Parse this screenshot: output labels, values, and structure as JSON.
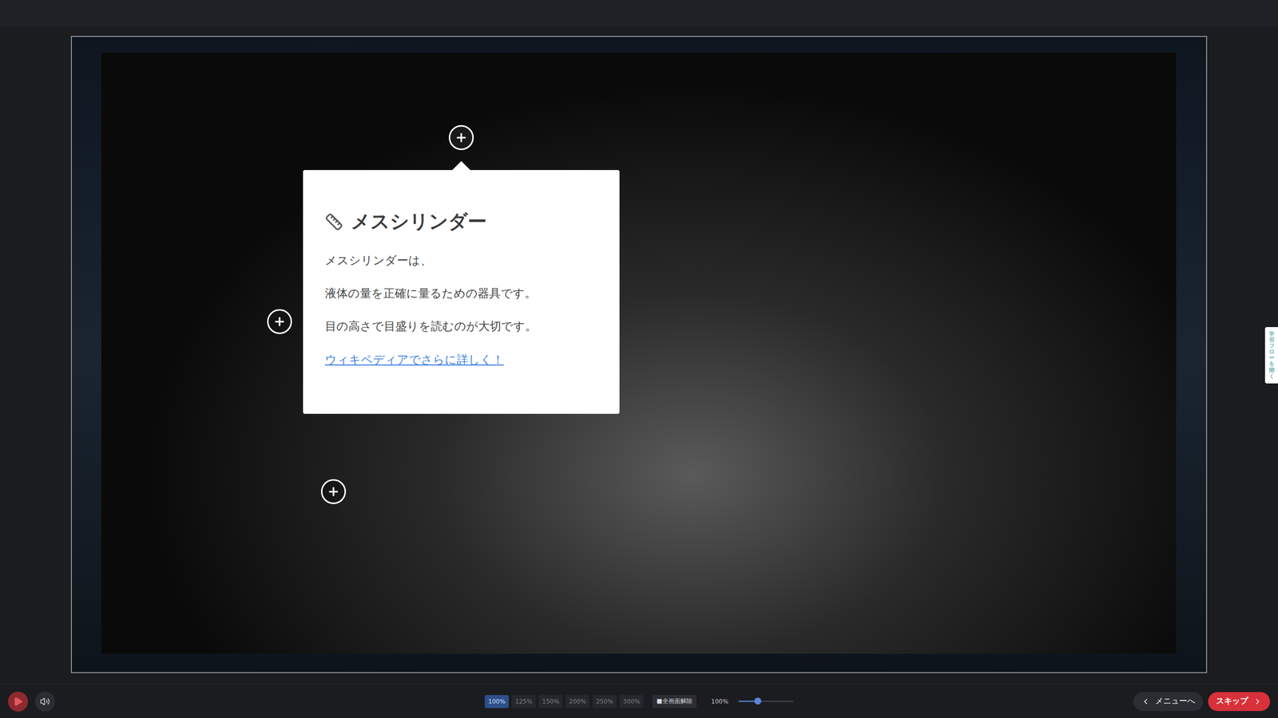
{
  "player": {
    "playing": false,
    "muted": false
  },
  "hotspots": [
    {
      "open": true
    },
    {
      "open": false
    },
    {
      "open": false
    }
  ],
  "popup": {
    "title": "メスシリンダー",
    "lines": [
      "メスシリンダーは、",
      "液体の量を正確に量るための器具です。",
      "目の高さで目盛りを読むのが大切です。"
    ],
    "link": "ウィキペディアでさらに詳しく！"
  },
  "side_tab": {
    "label": "学習フローを開く"
  },
  "zoom_options": [
    {
      "label": "100%",
      "selected": true
    },
    {
      "label": "125%",
      "selected": false
    },
    {
      "label": "150%",
      "selected": false
    },
    {
      "label": "200%",
      "selected": false
    },
    {
      "label": "250%",
      "selected": false
    },
    {
      "label": "300%",
      "selected": false
    }
  ],
  "fullscreen": {
    "icon": "■",
    "label": "全画面解除"
  },
  "zoom": {
    "reading": "100%",
    "level": 0.36
  },
  "nav": {
    "menu": "メニューへ",
    "skip": "スキップ"
  }
}
